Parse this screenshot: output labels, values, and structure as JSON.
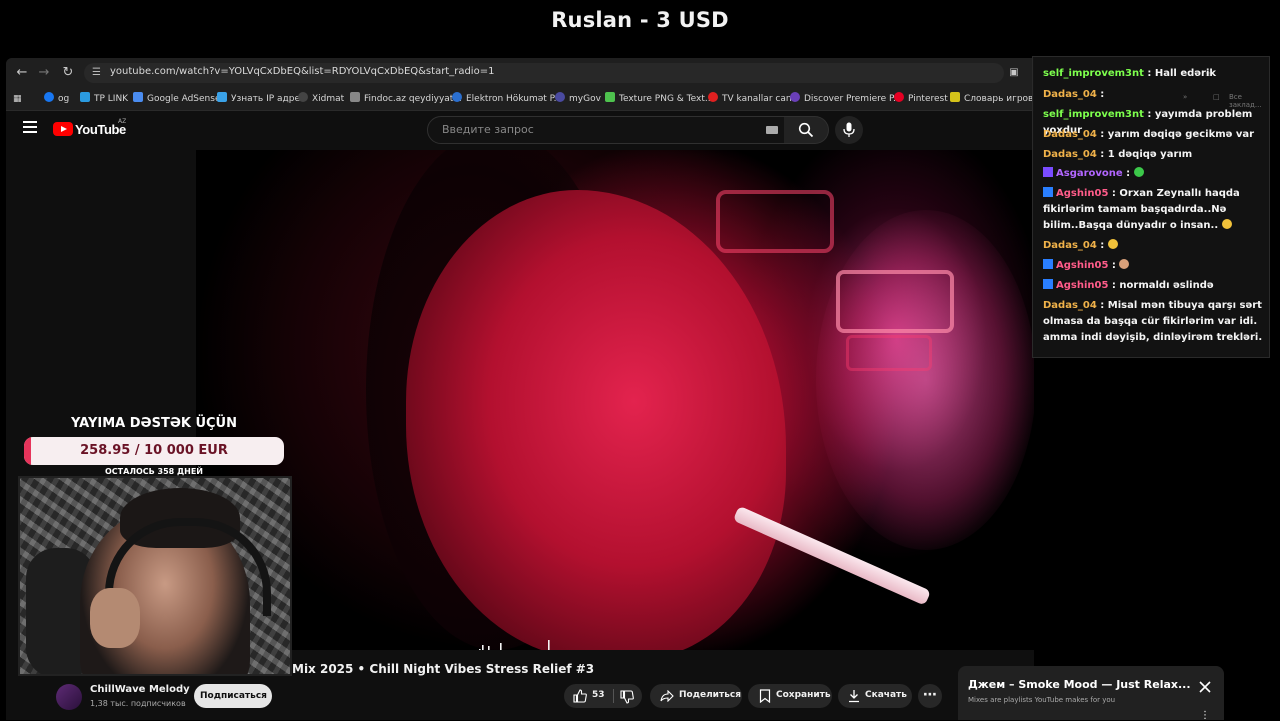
{
  "stream": {
    "top_title": "Ruslan - 3 USD"
  },
  "browser": {
    "url": "youtube.com/watch?v=YOLVqCxDbEQ&list=RDYOLVqCxDbEQ&start_radio=1",
    "bookmarks": [
      "og",
      "TP LINK",
      "Google AdSense",
      "Узнать IP адрес",
      "Xidmat",
      "Findoc.az qeydiyyat...",
      "Elektron Hökumət P...",
      "myGov",
      "Texture PNG & Text...",
      "TV kanallar canli",
      "Discover Premiere P...",
      "Pinterest",
      "Словарь игровых"
    ],
    "all_bookmarks": "Все заклад..."
  },
  "youtube": {
    "logo_text": "YouTube",
    "country": "AZ",
    "search_placeholder": "Введите запрос",
    "video_title": "Mix 2025 • Chill Night Vibes Stress Relief #3",
    "channel_name": "ChillWave Melody",
    "channel_subs": "1,38 тыс. подписчиков",
    "subscribe_label": "Подписаться",
    "like_count": "53",
    "share_label": "Поделиться",
    "save_label": "Сохранить",
    "download_label": "Скачать"
  },
  "chat": {
    "messages": [
      {
        "user": "self_improvem3nt",
        "user_color": "#7dff4d",
        "text": "Hall edərik",
        "badge": false
      },
      {
        "user": "Dadas_04",
        "user_color": "#f0b24a",
        "text": "",
        "badge": false
      },
      {
        "user": "self_improvem3nt",
        "user_color": "#7dff4d",
        "text": "yayımda problem yoxdur",
        "badge": false
      },
      {
        "user": "Dadas_04",
        "user_color": "#f0b24a",
        "text": "yarım dəqiqə gecikmə var",
        "badge": false
      },
      {
        "user": "Dadas_04",
        "user_color": "#f0b24a",
        "text": "1 dəqiqə yarım",
        "badge": false
      },
      {
        "user": "Asgarovone",
        "user_color": "#b266ff",
        "text": "",
        "badge": false
      },
      {
        "user": "Agshin05",
        "user_color": "#ff5c8a",
        "text": "Orxan Zeynallı haqda fikirlərim tamam başqadırda..Nə bilim..Başqa dünyadır o insan..",
        "badge": true
      },
      {
        "user": "Dadas_04",
        "user_color": "#f0b24a",
        "text": "",
        "badge": false
      },
      {
        "user": "Agshin05",
        "user_color": "#ff5c8a",
        "text": "",
        "badge": true
      },
      {
        "user": "Agshin05",
        "user_color": "#ff5c8a",
        "text": "normaldı əslində",
        "badge": true
      },
      {
        "user": "Dadas_04",
        "user_color": "#f0b24a",
        "text": "Misal mən tibuya qarşı sərt olmasa da başqa cür fikirlərim var idi. amma indi dəyişib, dinləyirəm trekləri.",
        "badge": false
      }
    ]
  },
  "donation": {
    "title": "YAYIMA DƏSTƏK ÜÇÜN",
    "amount_text": "258.95 / 10 000 EUR",
    "raised": 258.95,
    "goal": 10000,
    "days_left": "ОСТАЛОСЬ 358 ДНЕЙ",
    "bar_color": "#e6345b"
  },
  "miniplayer": {
    "title": "Джем – Smoke Mood — Just Relax...",
    "subtitle": "Mixes are playlists YouTube makes for you"
  },
  "icons": {
    "back": "arrow-left-icon",
    "forward": "arrow-right-icon",
    "reload": "reload-icon",
    "search": "search-icon",
    "mic": "mic-icon",
    "like": "thumbs-up-icon",
    "dislike": "thumbs-down-icon",
    "share": "share-icon",
    "save": "bookmark-icon",
    "download": "download-icon",
    "close": "close-icon"
  }
}
